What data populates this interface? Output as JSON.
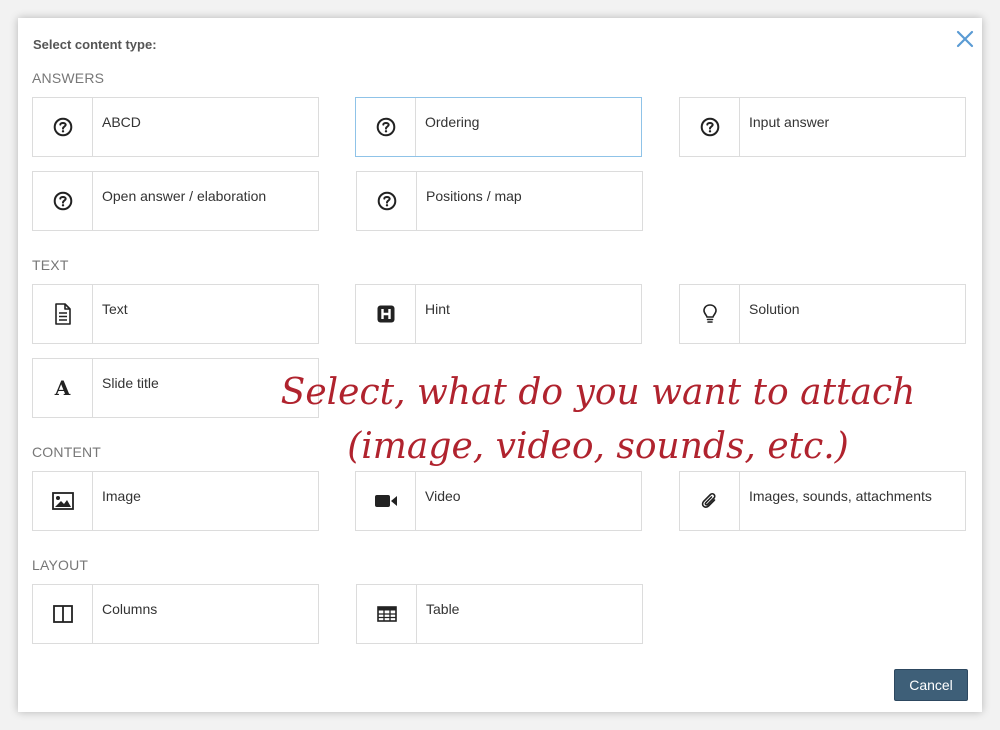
{
  "dialog": {
    "title": "Select content type:",
    "close_icon": "close-icon",
    "cancel_label": "Cancel",
    "accent_color": "#3e5f78",
    "selected_border_color": "#8fc3e8"
  },
  "sections": [
    {
      "label": "ANSWERS",
      "items": [
        {
          "label": "ABCD",
          "icon": "question-circle-icon"
        },
        {
          "label": "Ordering",
          "icon": "question-circle-icon",
          "selected": true
        },
        {
          "label": "Input answer",
          "icon": "question-circle-icon"
        },
        {
          "label": "Open answer / elaboration",
          "icon": "question-circle-icon"
        },
        {
          "label": "Positions / map",
          "icon": "question-circle-icon"
        }
      ]
    },
    {
      "label": "TEXT",
      "items": [
        {
          "label": "Text",
          "icon": "document-icon"
        },
        {
          "label": "Hint",
          "icon": "hint-h-icon"
        },
        {
          "label": "Solution",
          "icon": "lightbulb-icon"
        },
        {
          "label": "Slide title",
          "icon": "font-a-icon"
        }
      ]
    },
    {
      "label": "CONTENT",
      "items": [
        {
          "label": "Image",
          "icon": "image-icon"
        },
        {
          "label": "Video",
          "icon": "video-camera-icon"
        },
        {
          "label": "Images, sounds, attachments",
          "icon": "paperclip-icon"
        }
      ]
    },
    {
      "label": "LAYOUT",
      "items": [
        {
          "label": "Columns",
          "icon": "columns-icon"
        },
        {
          "label": "Table",
          "icon": "table-icon"
        }
      ]
    }
  ],
  "annotation": {
    "line1": "Select, what do you want to attach",
    "line2": "(image, video, sounds, etc.)",
    "color": "#b0232e"
  }
}
